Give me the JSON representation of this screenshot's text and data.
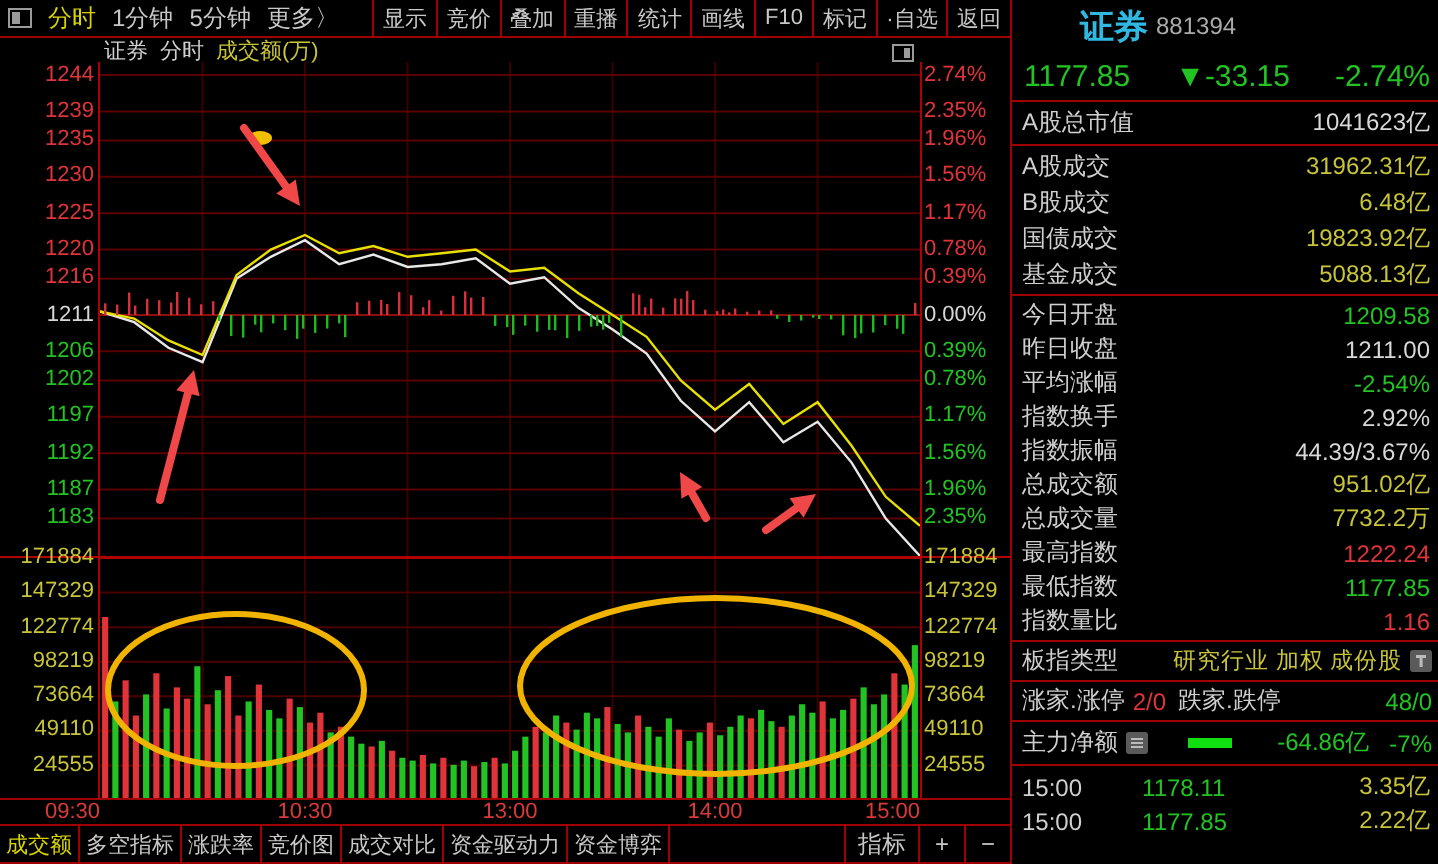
{
  "toolbar": {
    "periods": [
      {
        "label": "分时",
        "selected": true
      },
      {
        "label": "1分钟",
        "selected": false
      },
      {
        "label": "5分钟",
        "selected": false
      },
      {
        "label": "更多〉",
        "selected": false
      }
    ],
    "buttons": [
      "显示",
      "竞价",
      "叠加",
      "重播",
      "统计",
      "画线",
      "F10",
      "标记",
      "·自选",
      "返回"
    ]
  },
  "chart_header": {
    "name": "证券",
    "mode": "分时",
    "indicator": "成交额(万)"
  },
  "price_chart": {
    "percent_ticks": [
      {
        "label": "2.74%",
        "color": "#e0343a"
      },
      {
        "label": "2.35%",
        "color": "#e0343a"
      },
      {
        "label": "1.96%",
        "color": "#e0343a"
      },
      {
        "label": "1.56%",
        "color": "#e0343a"
      },
      {
        "label": "1.17%",
        "color": "#e0343a"
      },
      {
        "label": "0.78%",
        "color": "#e0343a"
      },
      {
        "label": "0.39%",
        "color": "#e0343a"
      },
      {
        "label": "0.00%",
        "color": "#d8d8d8"
      },
      {
        "label": "0.39%",
        "color": "#22c322"
      },
      {
        "label": "0.78%",
        "color": "#22c322"
      },
      {
        "label": "1.17%",
        "color": "#22c322"
      },
      {
        "label": "1.56%",
        "color": "#22c322"
      },
      {
        "label": "1.96%",
        "color": "#22c322"
      },
      {
        "label": "2.35%",
        "color": "#22c322"
      }
    ],
    "time_labels": [
      "09:30",
      "10:30",
      "13:00",
      "14:00",
      "15:00"
    ],
    "chart_data": {
      "type": "line",
      "grid": true,
      "ref_lines": [
        {
          "axis": "y",
          "value": 1211
        }
      ],
      "series": [
        {
          "color": "#e8e8e8",
          "values": [
            1211.5,
            1210,
            1206.5,
            1204.5,
            1216,
            1219,
            1221.3,
            1218,
            1219.3,
            1217.6,
            1218,
            1218.8,
            1215.3,
            1216.2,
            1212,
            1209,
            1205.7,
            1199.2,
            1195,
            1199,
            1193.5,
            1196.3,
            1190.7,
            1183,
            1177.85
          ]
        },
        {
          "color": "#e8e000",
          "values": [
            1211.5,
            1210.5,
            1207.5,
            1205.5,
            1216.5,
            1220,
            1222,
            1219.5,
            1220.5,
            1219,
            1219.5,
            1220,
            1217,
            1217.5,
            1214,
            1211,
            1208,
            1202,
            1198,
            1201.5,
            1196,
            1199,
            1193,
            1186,
            1182
          ]
        }
      ],
      "ylim": [
        1177.85,
        1244.15
      ],
      "yticks": [
        {
          "value": 1244,
          "label": "1244"
        },
        {
          "value": 1239,
          "label": "1239"
        },
        {
          "value": 1235,
          "label": "1235"
        },
        {
          "value": 1230,
          "label": "1230"
        },
        {
          "value": 1225,
          "label": "1225"
        },
        {
          "value": 1220,
          "label": "1220"
        },
        {
          "value": 1216,
          "label": "1216"
        },
        {
          "value": 1211,
          "label": "1211"
        },
        {
          "value": 1206,
          "label": "1206"
        },
        {
          "value": 1202,
          "label": "1202"
        },
        {
          "value": 1197,
          "label": "1197"
        },
        {
          "value": 1192,
          "label": "1192"
        },
        {
          "value": 1187,
          "label": "1187"
        },
        {
          "value": 1183,
          "label": "1183"
        }
      ]
    }
  },
  "volume_chart": {
    "chart_data": {
      "type": "bar",
      "grid": true,
      "ylim": [
        0,
        171884
      ],
      "yticks": [
        {
          "value": 171884,
          "label": "171884"
        },
        {
          "value": 147329,
          "label": "147329"
        },
        {
          "value": 122774,
          "label": "122774"
        },
        {
          "value": 98219,
          "label": "98219"
        },
        {
          "value": 73664,
          "label": "73664"
        },
        {
          "value": 49110,
          "label": "49110"
        },
        {
          "value": 24555,
          "label": "24555"
        }
      ],
      "series": [
        {
          "color": "#e0343a",
          "values": [
            130000,
            null,
            85000,
            60000,
            null,
            90000,
            null,
            80000,
            72000,
            null,
            68000,
            null,
            88000,
            60000,
            null,
            82000,
            null,
            null,
            72000,
            null,
            55000,
            62000,
            null,
            52000,
            null,
            null,
            38000,
            null,
            35000,
            null,
            null,
            32000,
            null,
            30000,
            null,
            null,
            24000,
            null,
            30000,
            null,
            null,
            null,
            52000,
            null,
            null,
            55000,
            null,
            null,
            null,
            66000,
            null,
            null,
            60000,
            null,
            null,
            null,
            50000,
            null,
            null,
            55000,
            null,
            null,
            null,
            58000,
            null,
            null,
            52000,
            null,
            null,
            null,
            70000,
            null,
            null,
            72000,
            null,
            null,
            null,
            90000,
            null,
            null
          ]
        },
        {
          "color": "#22c322",
          "values": [
            null,
            70000,
            null,
            null,
            75000,
            null,
            65000,
            null,
            null,
            95000,
            null,
            78000,
            null,
            null,
            70000,
            null,
            64000,
            58000,
            null,
            66000,
            null,
            null,
            48000,
            null,
            45000,
            40000,
            null,
            42000,
            null,
            30000,
            28000,
            null,
            26000,
            null,
            25000,
            28000,
            null,
            27000,
            null,
            26000,
            35000,
            45000,
            null,
            48000,
            60000,
            null,
            50000,
            62000,
            58000,
            null,
            54000,
            48000,
            null,
            52000,
            45000,
            58000,
            null,
            42000,
            48000,
            null,
            46000,
            52000,
            60000,
            null,
            64000,
            56000,
            null,
            60000,
            68000,
            62000,
            null,
            58000,
            64000,
            null,
            80000,
            68000,
            75000,
            null,
            82000,
            110000
          ]
        }
      ]
    },
    "right_labels": [
      "171884",
      "147329",
      "122774",
      "98219",
      "73664",
      "49110",
      "24555"
    ]
  },
  "bottom_tabs": [
    {
      "label": "成交额",
      "selected": true
    },
    {
      "label": "多空指标",
      "selected": false
    },
    {
      "label": "涨跌率",
      "selected": false
    },
    {
      "label": "竞价图",
      "selected": false
    },
    {
      "label": "成交对比",
      "selected": false
    },
    {
      "label": "资金驱动力",
      "selected": false
    },
    {
      "label": "资金博弈",
      "selected": false
    }
  ],
  "bottom_buttons": [
    "指标",
    "+",
    "−"
  ],
  "quote": {
    "name": "证券",
    "code": "881394",
    "price": "1177.85",
    "change": "▼-33.15",
    "change_pct": "-2.74%",
    "color": "#22c322"
  },
  "stat_groups": [
    [
      {
        "label": "A股总市值",
        "value": "1041623亿",
        "color": "#d8d8d8"
      }
    ],
    [
      {
        "label": "A股成交",
        "value": "31962.31亿",
        "color": "#c8c43a"
      },
      {
        "label": "B股成交",
        "value": "6.48亿",
        "color": "#c8c43a"
      },
      {
        "label": "国债成交",
        "value": "19823.92亿",
        "color": "#c8c43a"
      },
      {
        "label": "基金成交",
        "value": "5088.13亿",
        "color": "#c8c43a"
      }
    ],
    [
      {
        "label": "今日开盘",
        "value": "1209.58",
        "color": "#22c322"
      },
      {
        "label": "昨日收盘",
        "value": "1211.00",
        "color": "#d8d8d8"
      },
      {
        "label": "平均涨幅",
        "value": "-2.54%",
        "color": "#22c322"
      },
      {
        "label": "指数换手",
        "value": "2.92%",
        "color": "#d8d8d8"
      },
      {
        "label": "指数振幅",
        "value": "44.39/3.67%",
        "color": "#d8d8d8"
      },
      {
        "label": "总成交额",
        "value": "951.02亿",
        "color": "#c8c43a"
      },
      {
        "label": "总成交量",
        "value": "7732.2万",
        "color": "#c8c43a"
      },
      {
        "label": "最高指数",
        "value": "1222.24",
        "color": "#e0343a"
      },
      {
        "label": "最低指数",
        "value": "1177.85",
        "color": "#22c322"
      },
      {
        "label": "指数量比",
        "value": "1.16",
        "color": "#e0343a"
      }
    ]
  ],
  "sector": {
    "label": "板指类型",
    "value": "研究行业 加权 成份股"
  },
  "breadth": {
    "up_label": "涨家.涨停",
    "up_value": "2/0",
    "down_label": "跌家.跌停",
    "down_value": "48/0"
  },
  "main_flow": {
    "label": "主力净额",
    "amount": "-64.86亿",
    "pct": "-7%"
  },
  "trades": [
    {
      "time": "15:00",
      "price": "1178.11",
      "amount": "3.35亿"
    },
    {
      "time": "15:00",
      "price": "1177.85",
      "amount": "2.22亿"
    }
  ]
}
